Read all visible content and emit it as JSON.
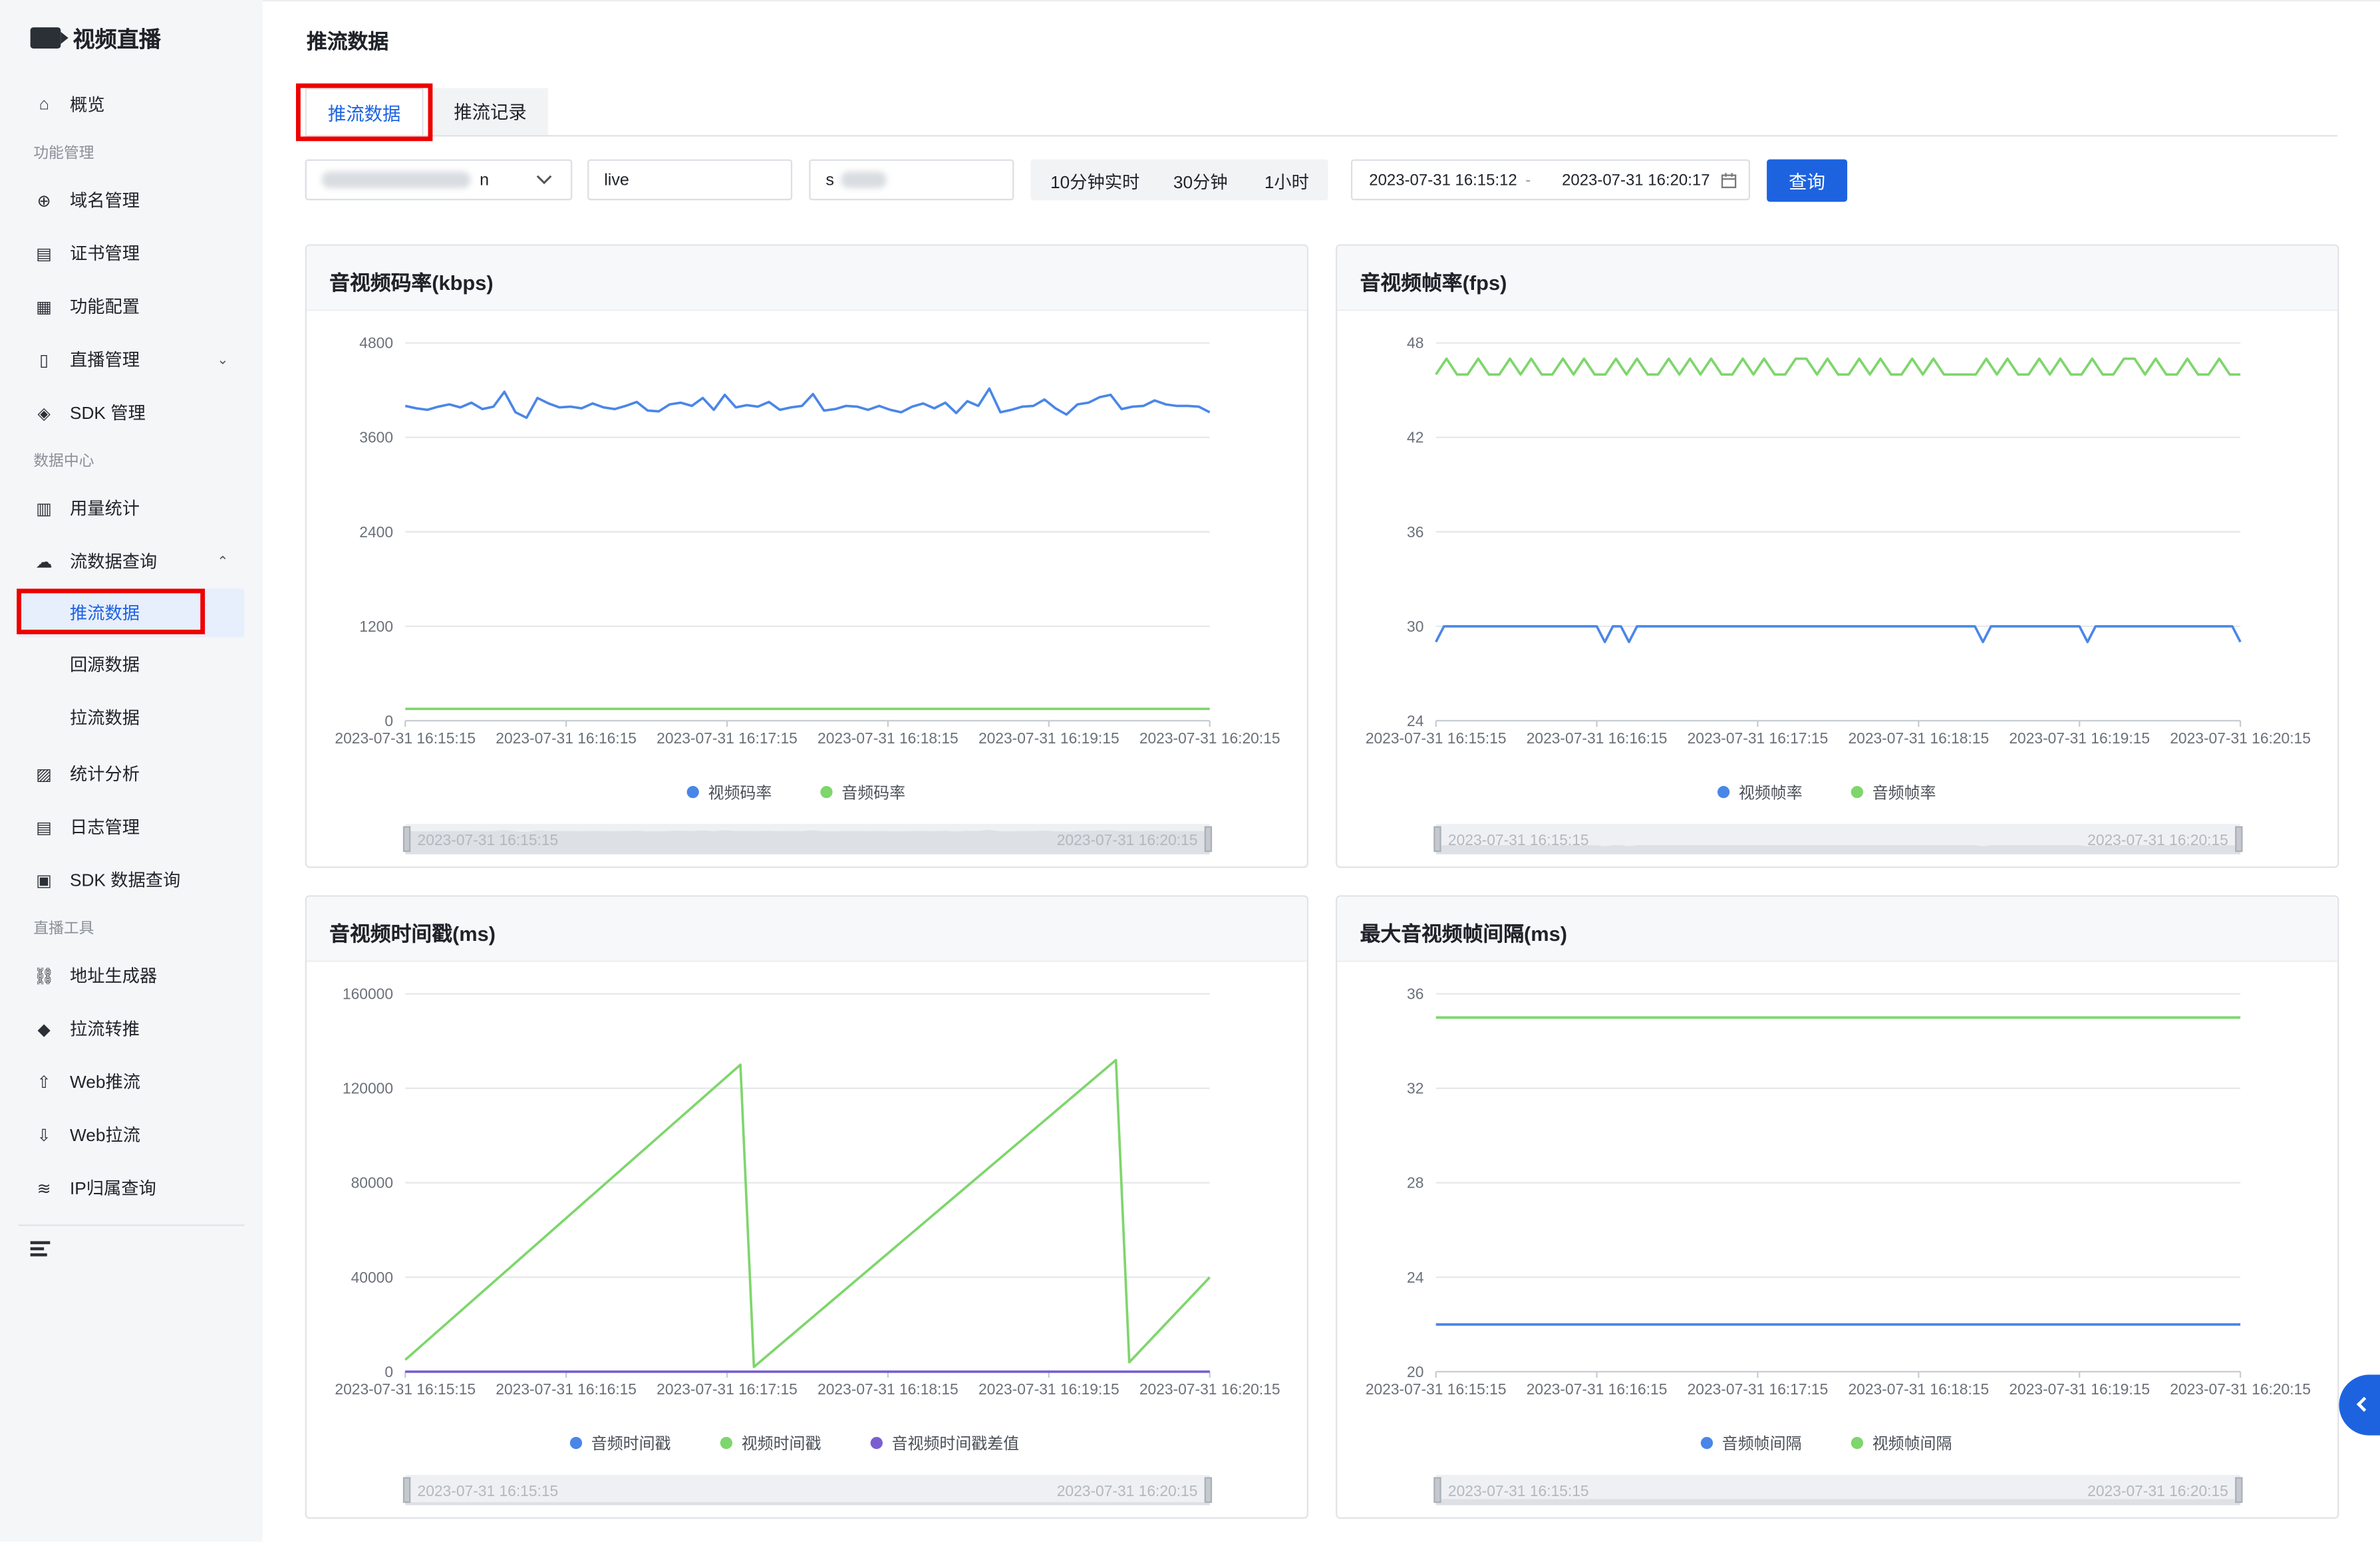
{
  "app": {
    "brand": "视频直播",
    "page_title": "推流数据"
  },
  "sidebar": {
    "items": [
      {
        "type": "item",
        "label": "概览",
        "icon": "home-icon"
      },
      {
        "type": "group",
        "label": "功能管理"
      },
      {
        "type": "item",
        "label": "域名管理",
        "icon": "globe-icon"
      },
      {
        "type": "item",
        "label": "证书管理",
        "icon": "certificate-icon"
      },
      {
        "type": "item",
        "label": "功能配置",
        "icon": "grid-icon"
      },
      {
        "type": "item",
        "label": "直播管理",
        "icon": "mobile-icon",
        "chevron": "down"
      },
      {
        "type": "item",
        "label": "SDK 管理",
        "icon": "layers-icon"
      },
      {
        "type": "group",
        "label": "数据中心"
      },
      {
        "type": "item",
        "label": "用量统计",
        "icon": "bar-chart-icon"
      },
      {
        "type": "item",
        "label": "流数据查询",
        "icon": "cloud-icon",
        "chevron": "up"
      },
      {
        "type": "sub",
        "label": "推流数据",
        "active": true
      },
      {
        "type": "sub",
        "label": "回源数据"
      },
      {
        "type": "sub",
        "label": "拉流数据"
      },
      {
        "type": "item",
        "label": "统计分析",
        "icon": "analytics-icon"
      },
      {
        "type": "item",
        "label": "日志管理",
        "icon": "log-icon"
      },
      {
        "type": "item",
        "label": "SDK 数据查询",
        "icon": "sdk-icon"
      },
      {
        "type": "group",
        "label": "直播工具"
      },
      {
        "type": "item",
        "label": "地址生成器",
        "icon": "link-icon"
      },
      {
        "type": "item",
        "label": "拉流转推",
        "icon": "cube-icon"
      },
      {
        "type": "item",
        "label": "Web推流",
        "icon": "upload-icon"
      },
      {
        "type": "item",
        "label": "Web拉流",
        "icon": "download-icon"
      },
      {
        "type": "item",
        "label": "IP归属查询",
        "icon": "wifi-icon"
      }
    ]
  },
  "tabs": [
    {
      "label": "推流数据",
      "active": true
    },
    {
      "label": "推流记录",
      "active": false
    }
  ],
  "filters": {
    "domain_value": "n",
    "app_value": "live",
    "stream_value": "s",
    "ranges": [
      "10分钟实时",
      "30分钟",
      "1小时"
    ],
    "date_start": "2023-07-31 16:15:12",
    "date_sep": "-",
    "date_end": "2023-07-31 16:20:17",
    "query_label": "查询"
  },
  "colors": {
    "accent": "#1d63e0",
    "series_blue": "#4a86e8",
    "series_green": "#7ed66c",
    "series_purple": "#7b5fd1",
    "highlight": "#ee0000"
  },
  "chart_data": [
    {
      "type": "line",
      "title": "音视频码率(kbps)",
      "x_ticks": [
        "2023-07-31 16:15:15",
        "2023-07-31 16:16:15",
        "2023-07-31 16:17:15",
        "2023-07-31 16:18:15",
        "2023-07-31 16:19:15",
        "2023-07-31 16:20:15"
      ],
      "ylim": [
        0,
        4800
      ],
      "y_ticks": [
        0,
        1200,
        2400,
        3600,
        4800
      ],
      "series": [
        {
          "name": "视频码率",
          "color": "#4a86e8",
          "values": [
            4000,
            3970,
            3950,
            3990,
            4020,
            3980,
            4040,
            3960,
            3990,
            4180,
            3920,
            3850,
            4100,
            4030,
            3980,
            3990,
            3970,
            4030,
            3980,
            3960,
            4000,
            4050,
            3940,
            3930,
            4020,
            4040,
            4000,
            4100,
            3950,
            4140,
            3980,
            4010,
            3990,
            4050,
            3950,
            3980,
            4000,
            4150,
            3940,
            3960,
            4000,
            3990,
            3950,
            4000,
            3950,
            3920,
            3990,
            4030,
            3970,
            4040,
            3910,
            4060,
            4000,
            4220,
            3920,
            3950,
            3990,
            4000,
            4080,
            3970,
            3890,
            4020,
            4040,
            4110,
            4140,
            3960,
            3990,
            4000,
            4070,
            4020,
            4000,
            4000,
            3990,
            3920
          ]
        },
        {
          "name": "音频码率",
          "color": "#7ed66c",
          "values": [
            150,
            150,
            150,
            150,
            150,
            150,
            150,
            150,
            150,
            150,
            150,
            150,
            150,
            150,
            150,
            150,
            150,
            150,
            150,
            150,
            150,
            150,
            150,
            150,
            150,
            150,
            150,
            150,
            150,
            150,
            150,
            150,
            150,
            150,
            150,
            150,
            150,
            150,
            150,
            150,
            150,
            150,
            150,
            150,
            150,
            150,
            150,
            150,
            150,
            150,
            150,
            150,
            150,
            150,
            150,
            150,
            150,
            150,
            150,
            150,
            150,
            150,
            150,
            150,
            150,
            150,
            150,
            150,
            150,
            150,
            150,
            150,
            150,
            150
          ]
        }
      ],
      "zoom_labels": [
        "2023-07-31 16:15:15",
        "2023-07-31 16:20:15"
      ]
    },
    {
      "type": "line",
      "title": "音视频帧率(fps)",
      "x_ticks": [
        "2023-07-31 16:15:15",
        "2023-07-31 16:16:15",
        "2023-07-31 16:17:15",
        "2023-07-31 16:18:15",
        "2023-07-31 16:19:15",
        "2023-07-31 16:20:15"
      ],
      "ylim": [
        24,
        48
      ],
      "y_ticks": [
        24,
        30,
        36,
        42,
        48
      ],
      "series": [
        {
          "name": "视频帧率",
          "color": "#4a86e8",
          "values": [
            29,
            30,
            30,
            30,
            30,
            30,
            30,
            30,
            30,
            30,
            30,
            30,
            30,
            30,
            30,
            30,
            30,
            30,
            30,
            30,
            30,
            29,
            30,
            30,
            29,
            30,
            30,
            30,
            30,
            30,
            30,
            30,
            30,
            30,
            30,
            30,
            30,
            30,
            30,
            30,
            30,
            30,
            30,
            30,
            30,
            30,
            30,
            30,
            30,
            30,
            30,
            30,
            30,
            30,
            30,
            30,
            30,
            30,
            30,
            30,
            30,
            30,
            30,
            30,
            30,
            30,
            30,
            30,
            29,
            30,
            30,
            30,
            30,
            30,
            30,
            30,
            30,
            30,
            30,
            30,
            30,
            29,
            30,
            30,
            30,
            30,
            30,
            30,
            30,
            30,
            30,
            30,
            30,
            30,
            30,
            30,
            30,
            30,
            30,
            30,
            29
          ]
        },
        {
          "name": "音频帧率",
          "color": "#7ed66c",
          "values": [
            46,
            47,
            46,
            46,
            47,
            46,
            46,
            47,
            46,
            47,
            46,
            46,
            47,
            46,
            47,
            46,
            46,
            47,
            46,
            47,
            46,
            46,
            47,
            46,
            47,
            46,
            47,
            46,
            46,
            47,
            46,
            47,
            46,
            46,
            47,
            47,
            46,
            47,
            46,
            46,
            47,
            46,
            47,
            46,
            46,
            47,
            46,
            47,
            46,
            46,
            46,
            46,
            47,
            46,
            47,
            46,
            46,
            47,
            46,
            47,
            46,
            46,
            47,
            46,
            46,
            47,
            47,
            46,
            47,
            46,
            46,
            47,
            46,
            46,
            47,
            46,
            46
          ]
        }
      ],
      "zoom_labels": [
        "2023-07-31 16:15:15",
        "2023-07-31 16:20:15"
      ]
    },
    {
      "type": "line",
      "title": "音视频时间戳(ms)",
      "x_ticks": [
        "2023-07-31 16:15:15",
        "2023-07-31 16:16:15",
        "2023-07-31 16:17:15",
        "2023-07-31 16:18:15",
        "2023-07-31 16:19:15",
        "2023-07-31 16:20:15"
      ],
      "ylim": [
        0,
        160000
      ],
      "y_ticks": [
        0,
        40000,
        80000,
        120000,
        160000
      ],
      "series": [
        {
          "name": "音频时间戳",
          "color": "#4a86e8",
          "x": [
            0,
            300
          ],
          "values": [
            0,
            0
          ]
        },
        {
          "name": "视频时间戳",
          "color": "#7ed66c",
          "x": [
            0,
            125,
            130,
            265,
            270,
            300
          ],
          "values": [
            5000,
            130000,
            2000,
            132000,
            4000,
            40000
          ]
        },
        {
          "name": "音视频时间戳差值",
          "color": "#7b5fd1",
          "x": [
            0,
            300
          ],
          "values": [
            0,
            0
          ]
        }
      ],
      "zoom_labels": [
        "2023-07-31 16:15:15",
        "2023-07-31 16:20:15"
      ]
    },
    {
      "type": "line",
      "title": "最大音视频帧间隔(ms)",
      "x_ticks": [
        "2023-07-31 16:15:15",
        "2023-07-31 16:16:15",
        "2023-07-31 16:17:15",
        "2023-07-31 16:18:15",
        "2023-07-31 16:19:15",
        "2023-07-31 16:20:15"
      ],
      "ylim": [
        20,
        36
      ],
      "y_ticks": [
        20,
        24,
        28,
        32,
        36
      ],
      "series": [
        {
          "name": "音频帧间隔",
          "color": "#4a86e8",
          "x": [
            0,
            300
          ],
          "values": [
            22,
            22
          ]
        },
        {
          "name": "视频帧间隔",
          "color": "#7ed66c",
          "x": [
            0,
            300
          ],
          "values": [
            35,
            35
          ]
        }
      ],
      "zoom_labels": [
        "2023-07-31 16:15:15",
        "2023-07-31 16:20:15"
      ]
    }
  ]
}
